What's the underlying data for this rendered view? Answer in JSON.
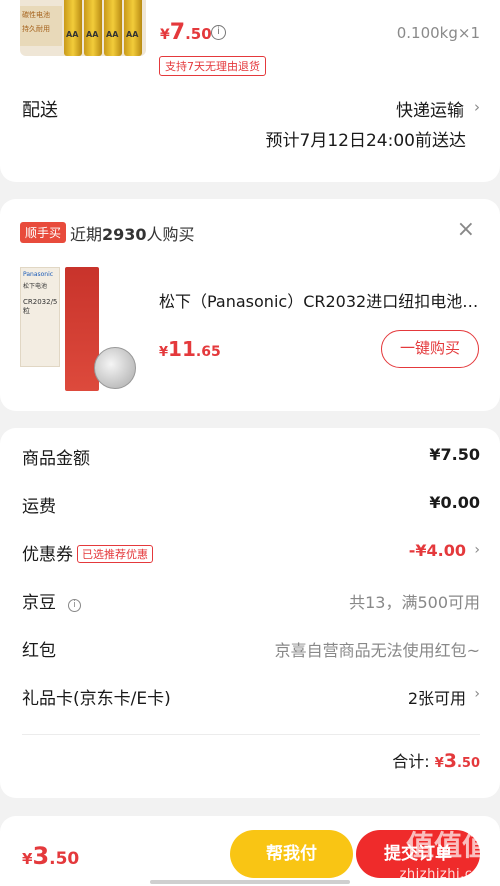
{
  "product1": {
    "thumb_labels": [
      "碳性电池",
      "持久耐用"
    ],
    "price_currency": "¥",
    "price_int": "7",
    "price_dec": ".50",
    "info_icon": "i",
    "weight": "0.100kg",
    "qty": "×1",
    "return_tag": "支持7天无理由退货"
  },
  "delivery": {
    "label": "配送",
    "method": "快递运输",
    "eta": "预计7月12日24:00前送达"
  },
  "recommend": {
    "tag": "顺手买",
    "recent_prefix": "近期",
    "recent_count": "2930",
    "recent_suffix": "人购买",
    "close": "×",
    "thumb_brand": "Panasonic",
    "thumb_brand_cn": "松下电池",
    "thumb_model": "CR2032/5粒",
    "title": "松下（Panasonic）CR2032进口纽扣电池…",
    "price_currency": "¥",
    "price_int": "11",
    "price_dec": ".65",
    "buy_button": "一键购买"
  },
  "summary": {
    "rows": [
      {
        "label": "商品金额",
        "value": "¥7.50"
      },
      {
        "label": "运费",
        "value": "¥0.00"
      },
      {
        "label": "优惠券",
        "tag": "已选推荐优惠",
        "value": "-¥4.00"
      },
      {
        "label": "京豆",
        "value": "共13，满500可用"
      },
      {
        "label": "红包",
        "value": "京喜自营商品无法使用红包~"
      },
      {
        "label": "礼品卡(京东卡/E卡)",
        "value": "2张可用"
      }
    ],
    "total_label": "合计:",
    "total_currency": "¥",
    "total_int": "3",
    "total_dec": ".50"
  },
  "bottom_bar": {
    "price_currency": "¥",
    "price_int": "3",
    "price_dec": ".50",
    "help_pay": "帮我付",
    "submit": "提交订单",
    "watermark": "zhizhizhi.com",
    "watermark_glyphs": "值值值"
  },
  "colors": {
    "accent_red": "#e4393c",
    "help_pay_yellow": "#f9c514",
    "submit_red": "#ef2b2b"
  }
}
